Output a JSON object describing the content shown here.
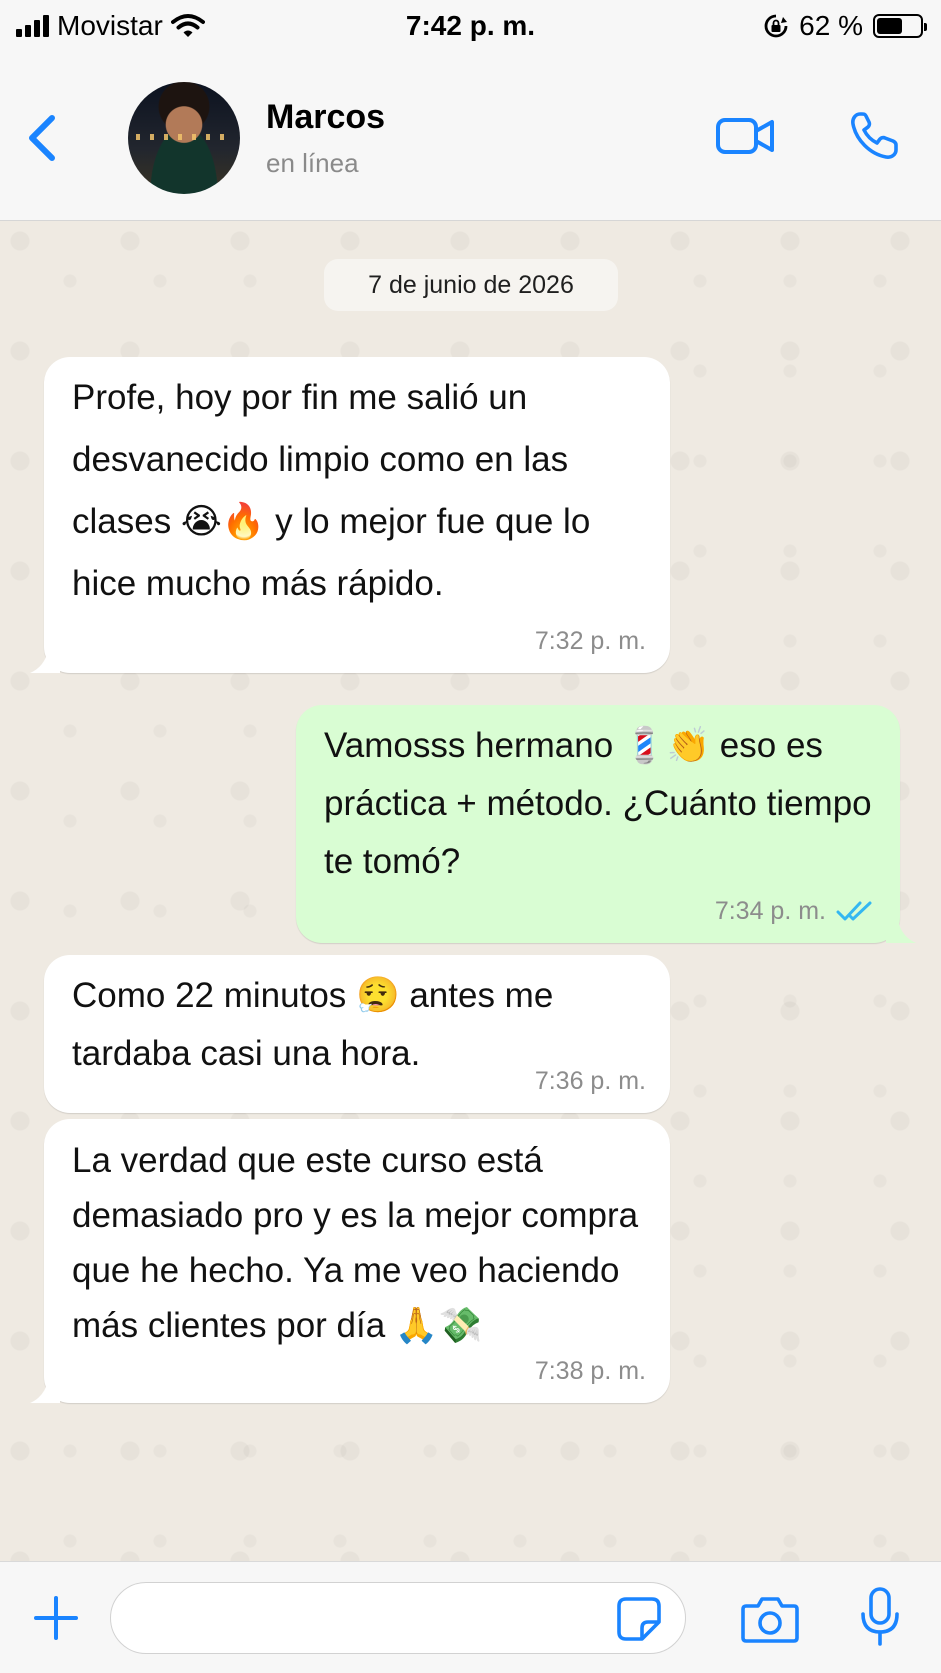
{
  "status_bar": {
    "carrier": "Movistar",
    "time": "7:42 p. m.",
    "battery_percent_text": "62 %",
    "battery_level": 0.62,
    "icons": [
      "signal-icon",
      "wifi-icon",
      "rotation-lock-icon",
      "battery-icon"
    ]
  },
  "header": {
    "contact_name": "Marcos",
    "contact_status": "en línea",
    "icons": [
      "back-chevron-icon",
      "video-camera-icon",
      "phone-icon"
    ]
  },
  "chat": {
    "date_separator": "7 de junio de 2026",
    "messages": [
      {
        "direction": "incoming",
        "lines": [
          "Profe, hoy por fin me salió un",
          "desvanecido limpio como en las",
          "clases 😭🔥 y lo mejor fue que lo",
          "hice mucho más rápido."
        ],
        "time": "7:32 p. m."
      },
      {
        "direction": "outgoing",
        "lines": [
          "Vamosss hermano 💈👏 eso es",
          "práctica + método. ¿Cuánto tiempo",
          "te tomó?"
        ],
        "time": "7:34 p. m.",
        "status": "read"
      },
      {
        "direction": "incoming",
        "lines": [
          "Como 22 minutos 😮‍💨 antes me",
          "tardaba casi una hora."
        ],
        "time": "7:36 p. m."
      },
      {
        "direction": "incoming",
        "lines": [
          "La verdad que este curso está",
          "demasiado pro y es la mejor compra",
          "que he hecho. Ya me veo haciendo",
          "más clientes por día 🙏💸"
        ],
        "time": "7:38 p. m."
      }
    ]
  },
  "input_bar": {
    "placeholder": "",
    "icons": [
      "plus-icon",
      "sticker-icon",
      "camera-icon",
      "microphone-icon"
    ]
  },
  "colors": {
    "accent_blue": "#1a84ff",
    "incoming_bubble": "#ffffff",
    "outgoing_bubble": "#d9fdd3",
    "chat_background": "#efeae2",
    "read_ticks": "#34b7f1"
  }
}
